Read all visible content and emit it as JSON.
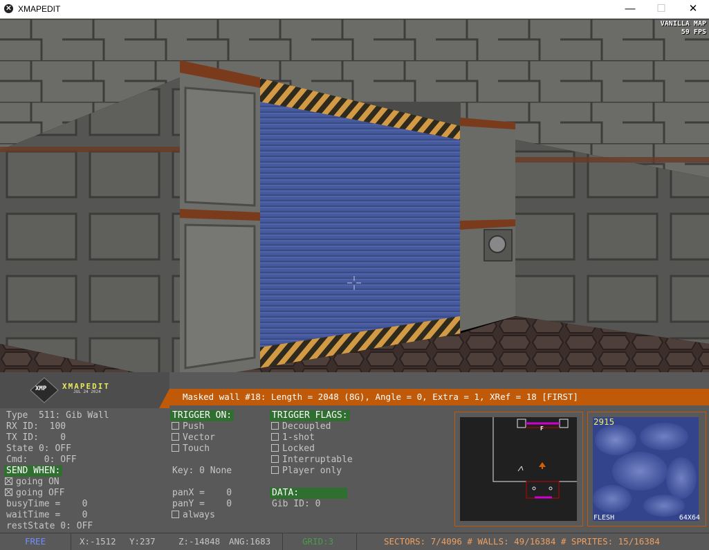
{
  "window": {
    "title": "XMAPEDIT",
    "icon": "xmapedit-app-icon"
  },
  "hud": {
    "map_type": "VANILLA MAP",
    "fps": "59 FPS"
  },
  "logo": {
    "name": "XMAPEDIT",
    "date": "JUL 24 2024",
    "badge": "XMP"
  },
  "message": "Masked wall #18: Length = 2048 (8G), Angle = 0, Extra = 1, XRef = 18 [FIRST]",
  "xobject": {
    "type": "Type  511: Gib Wall",
    "rx": "RX ID:  100",
    "tx": "TX ID:    0",
    "state": "State 0: OFF",
    "cmd": "Cmd:   0: OFF",
    "send_when": "SEND WHEN:",
    "going_on": "going ON",
    "going_off": "going OFF",
    "busy": "busyTime =    0",
    "wait": "waitTime =    0",
    "rest": "restState 0: OFF"
  },
  "trigger_on": {
    "header": "TRIGGER ON:",
    "push": "Push",
    "vector": "Vector",
    "touch": "Touch",
    "key": "Key: 0 None",
    "panx": "panX =    0",
    "pany": "panY =    0",
    "always": "always"
  },
  "trigger_flags": {
    "header": "TRIGGER FLAGS:",
    "decoupled": "Decoupled",
    "oneshot": "1-shot",
    "locked": "Locked",
    "interruptable": "Interruptable",
    "player_only": "Player only",
    "data_header": "DATA:",
    "gib_id": "Gib ID: 0"
  },
  "tile": {
    "number": "2915",
    "name": "FLESH",
    "size": "64X64"
  },
  "minimap": {
    "marker": "F"
  },
  "status": {
    "mode": "FREE",
    "x": "X:-1512",
    "y": "Y:237",
    "z": "Z:-14848",
    "ang": "ANG:1683",
    "grid": "GRID:3",
    "counts": "SECTORS: 7/4096 # WALLS: 49/16384 # SPRITES: 15/16384"
  },
  "colors": {
    "accent": "#c05a08",
    "panel": "#595959",
    "header_green": "#2f6f2f",
    "mode": "#6f8fff",
    "grid": "#4c9a4c",
    "counts": "#f0a060"
  }
}
